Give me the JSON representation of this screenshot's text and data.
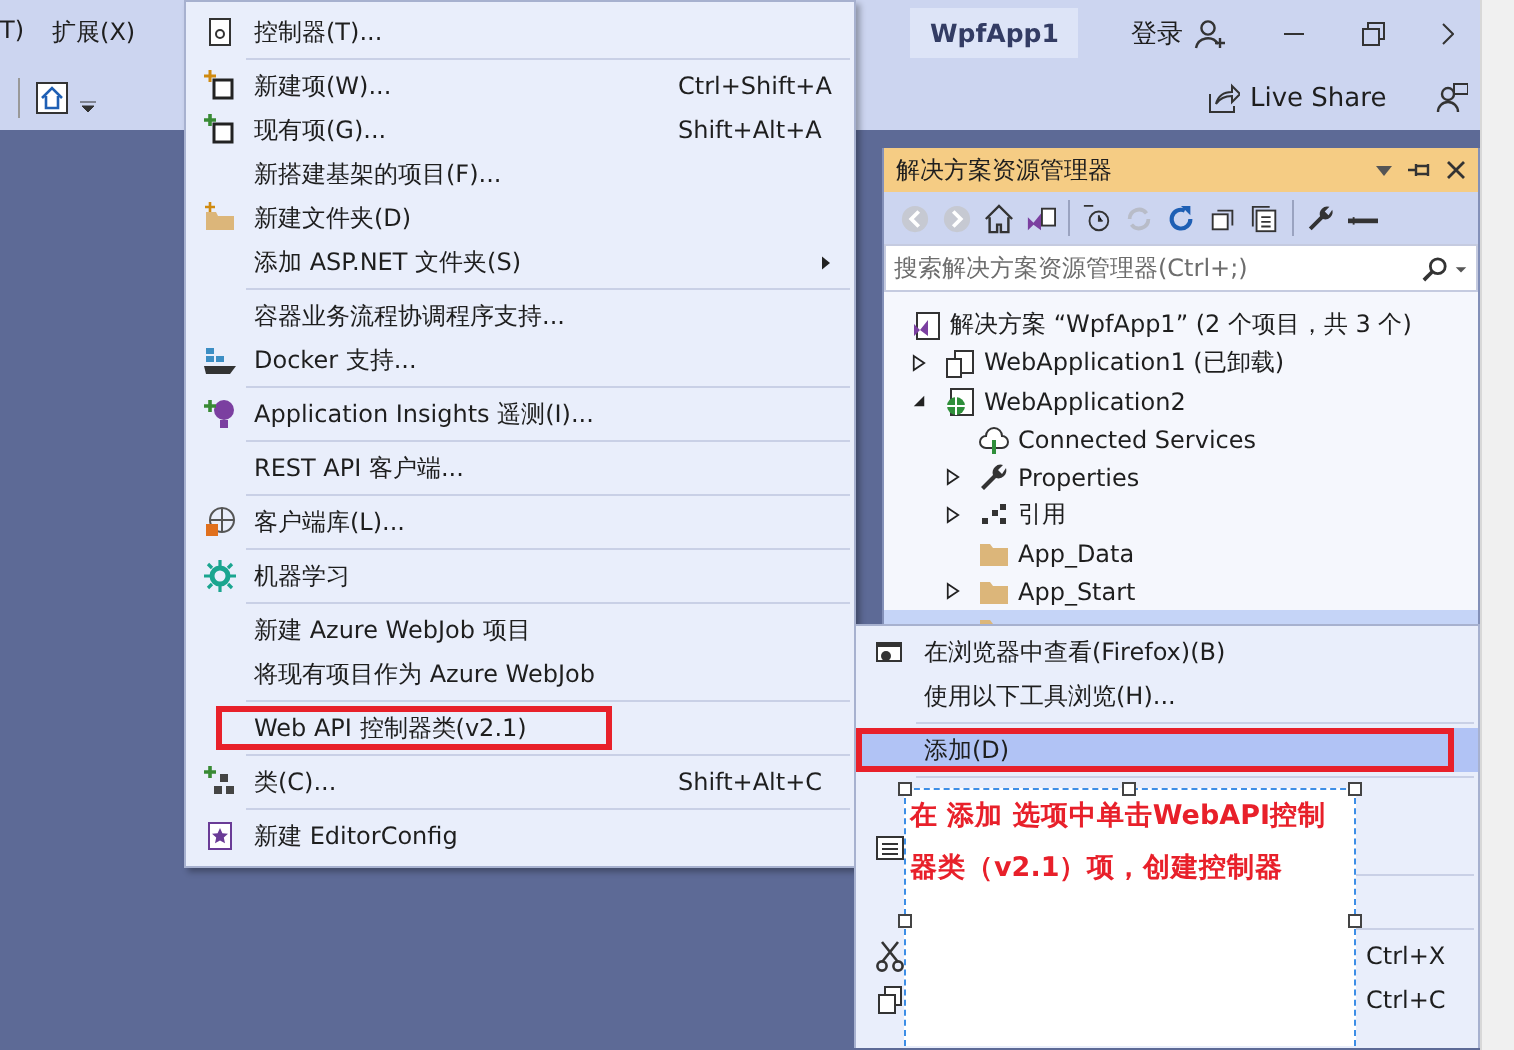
{
  "title_bar": {
    "menus": [
      "T)",
      "扩展(X)"
    ],
    "title": "WpfApp1",
    "sign_in": "登录"
  },
  "toolbar": {
    "live_share": "Live Share"
  },
  "solution_explorer": {
    "title": "解决方案资源管理器",
    "search": {
      "placeholder": "搜索解决方案资源管理器(Ctrl+;)"
    },
    "tree": [
      {
        "label": "解决方案 “WpfApp1” (2 个项目，共 3 个)",
        "kind": "solution",
        "selected": false,
        "children": [
          {
            "label": "WebApplication1 (已卸载)",
            "kind": "unloaded",
            "expanded": false,
            "selected": false
          },
          {
            "label": "WebApplication2",
            "kind": "web",
            "expanded": true,
            "selected": false,
            "children": [
              {
                "label": "Connected Services",
                "kind": "services",
                "selected": false
              },
              {
                "label": "Properties",
                "kind": "properties",
                "expanded": false,
                "selected": false
              },
              {
                "label": "引用",
                "kind": "references",
                "expanded": false,
                "selected": false
              },
              {
                "label": "App_Data",
                "kind": "folder",
                "selected": false
              },
              {
                "label": "App_Start",
                "kind": "folder",
                "expanded": false,
                "selected": false
              },
              {
                "kind": "folder",
                "selected": true
              }
            ]
          }
        ]
      }
    ]
  },
  "add_menu": {
    "items": [
      {
        "kind": "item",
        "label": "控制器(T)...",
        "highlighted": false
      },
      {
        "kind": "separator"
      },
      {
        "kind": "item",
        "label": "新建项(W)...",
        "shortcut": "Ctrl+Shift+A",
        "highlighted": false
      },
      {
        "kind": "item",
        "label": "现有项(G)...",
        "shortcut": "Shift+Alt+A",
        "highlighted": false
      },
      {
        "kind": "item",
        "label": "新搭建基架的项目(F)...",
        "highlighted": false
      },
      {
        "kind": "item",
        "label": "新建文件夹(D)",
        "highlighted": false
      },
      {
        "kind": "item",
        "label": "添加 ASP.NET 文件夹(S)",
        "submenu": true,
        "highlighted": false
      },
      {
        "kind": "separator"
      },
      {
        "kind": "item",
        "label": "容器业务流程协调程序支持...",
        "highlighted": false
      },
      {
        "kind": "item",
        "label": "Docker 支持...",
        "highlighted": false
      },
      {
        "kind": "separator"
      },
      {
        "kind": "item",
        "label": "Application Insights 遥测(I)...",
        "highlighted": false
      },
      {
        "kind": "separator"
      },
      {
        "kind": "item",
        "label": "REST API 客户端...",
        "highlighted": false
      },
      {
        "kind": "separator"
      },
      {
        "kind": "item",
        "label": "客户端库(L)...",
        "highlighted": false
      },
      {
        "kind": "separator"
      },
      {
        "kind": "item",
        "label": "机器学习",
        "highlighted": false
      },
      {
        "kind": "separator"
      },
      {
        "kind": "item",
        "label": "新建 Azure WebJob 项目",
        "highlighted": false
      },
      {
        "kind": "item",
        "label": "将现有项目作为 Azure WebJob",
        "highlighted": false
      },
      {
        "kind": "separator"
      },
      {
        "kind": "item",
        "label": "Web API 控制器类(v2.1)",
        "highlighted": true
      },
      {
        "kind": "separator"
      },
      {
        "kind": "item",
        "label": "类(C)...",
        "shortcut": "Shift+Alt+C",
        "highlighted": false
      },
      {
        "kind": "separator"
      },
      {
        "kind": "item",
        "label": "新建 EditorConfig",
        "highlighted": false
      }
    ]
  },
  "project_menu": {
    "items": [
      {
        "kind": "item",
        "label": "在浏览器中查看(Firefox)(B)",
        "selected": false,
        "highlighted": false
      },
      {
        "kind": "item",
        "label": "使用以下工具浏览(H)...",
        "selected": false,
        "highlighted": false
      },
      {
        "kind": "separator"
      },
      {
        "kind": "item",
        "label": "添加(D)",
        "selected": true,
        "highlighted": true
      },
      {
        "kind": "separator"
      },
      {
        "kind": "covered"
      },
      {
        "kind": "covered"
      },
      {
        "kind": "separator"
      },
      {
        "kind": "covered"
      },
      {
        "kind": "separator"
      },
      {
        "kind": "covered",
        "shortcut": "Ctrl+X"
      },
      {
        "kind": "covered",
        "shortcut": "Ctrl+C"
      }
    ]
  },
  "annotation": {
    "text": "在 添加 选项中单击WebAPI控制器类（v2.1）项，创建控制器"
  }
}
